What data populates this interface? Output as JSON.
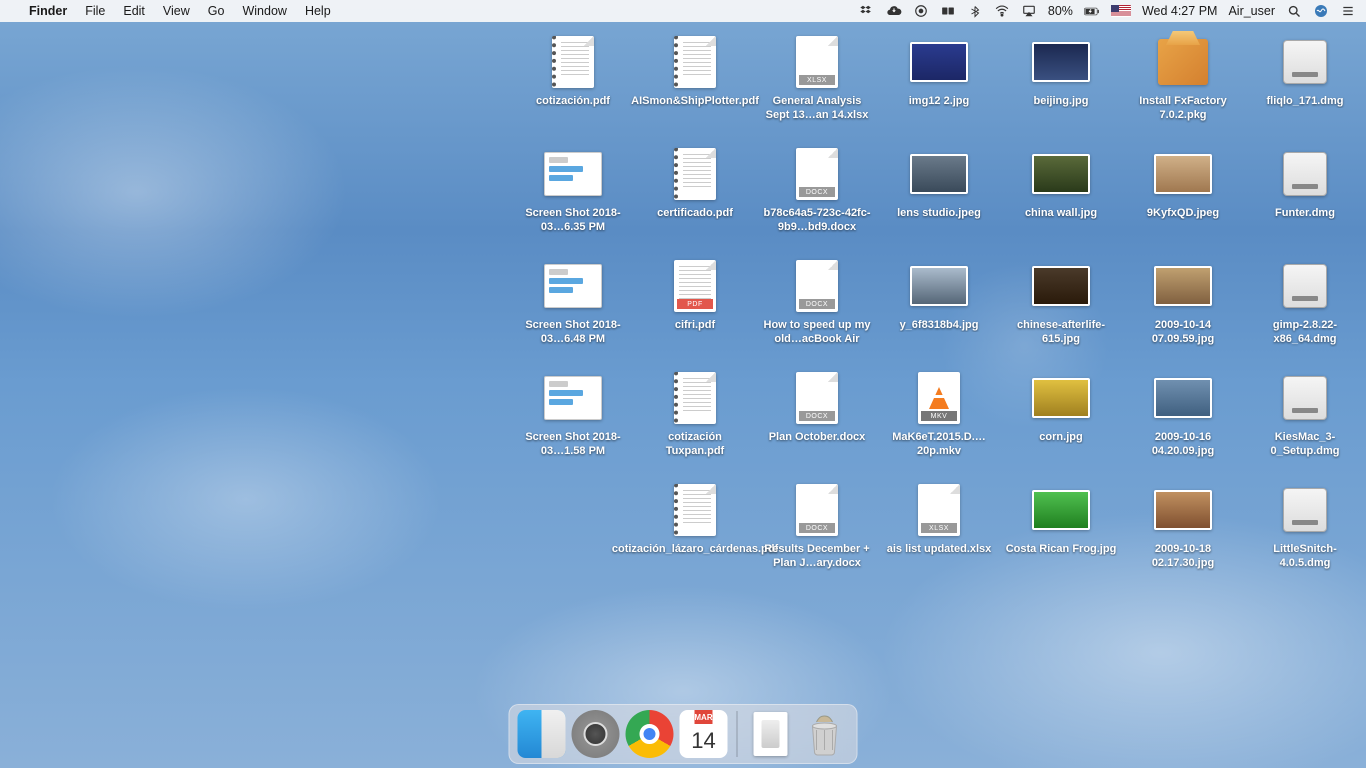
{
  "menubar": {
    "app": "Finder",
    "items": [
      "File",
      "Edit",
      "View",
      "Go",
      "Window",
      "Help"
    ],
    "battery": "80%",
    "clock": "Wed 4:27 PM",
    "user": "Air_user"
  },
  "dock": {
    "calendar_month": "MAR",
    "calendar_day": "14"
  },
  "files": {
    "r1": [
      {
        "label": "cotización.pdf",
        "type": "pdf-spiral"
      },
      {
        "label": "AISmon&ShipPlotter.pdf",
        "type": "pdf-spiral"
      },
      {
        "label": "General Analysis Sept 13…an 14.xlsx",
        "type": "xlsx"
      },
      {
        "label": "img12 2.jpg",
        "type": "jpg",
        "bg": "linear-gradient(#2a3b8f,#1c2766)"
      },
      {
        "label": "beijing.jpg",
        "type": "jpg",
        "bg": "linear-gradient(#1b2850,#3a5080)"
      },
      {
        "label": "Install FxFactory 7.0.2.pkg",
        "type": "pkg"
      },
      {
        "label": "fliqlo_171.dmg",
        "type": "dmg"
      }
    ],
    "r2": [
      {
        "label": "Screen Shot 2018-03…6.35 PM",
        "type": "screenshot"
      },
      {
        "label": "certificado.pdf",
        "type": "pdf-spiral"
      },
      {
        "label": "b78c64a5-723c-42fc-9b9…bd9.docx",
        "type": "docx"
      },
      {
        "label": "lens studio.jpeg",
        "type": "jpg",
        "bg": "linear-gradient(#6a7a8a,#3a4a5a)"
      },
      {
        "label": "china wall.jpg",
        "type": "jpg",
        "bg": "linear-gradient(#5a6a3a,#2a3a1a)"
      },
      {
        "label": "9KyfxQD.jpeg",
        "type": "jpg",
        "bg": "linear-gradient(#d0b088,#a07850)"
      },
      {
        "label": "Funter.dmg",
        "type": "dmg"
      }
    ],
    "r3": [
      {
        "label": "Screen Shot 2018-03…6.48 PM",
        "type": "screenshot"
      },
      {
        "label": "cifri.pdf",
        "type": "pdf"
      },
      {
        "label": "How to speed up my old…acBook Air",
        "type": "docx"
      },
      {
        "label": "y_6f8318b4.jpg",
        "type": "jpg",
        "bg": "linear-gradient(#aabbcc,#556677)"
      },
      {
        "label": "chinese-afterlife-615.jpg",
        "type": "jpg",
        "bg": "linear-gradient(#4a3a2a,#2a1a0a)"
      },
      {
        "label": "2009-10-14 07.09.59.jpg",
        "type": "jpg",
        "bg": "linear-gradient(#c0a070,#806040)"
      },
      {
        "label": "gimp-2.8.22-x86_64.dmg",
        "type": "dmg"
      }
    ],
    "r4": [
      {
        "label": "Screen Shot 2018-03…1.58 PM",
        "type": "screenshot"
      },
      {
        "label": "cotización Tuxpan.pdf",
        "type": "pdf-spiral"
      },
      {
        "label": "Plan October.docx",
        "type": "docx"
      },
      {
        "label": "MaK6eT.2015.D.…20p.mkv",
        "type": "mkv"
      },
      {
        "label": "corn.jpg",
        "type": "jpg",
        "bg": "linear-gradient(#e0c040,#a08020)"
      },
      {
        "label": "2009-10-16 04.20.09.jpg",
        "type": "jpg",
        "bg": "linear-gradient(#7090b0,#406080)"
      },
      {
        "label": "KiesMac_3-0_Setup.dmg",
        "type": "dmg"
      }
    ],
    "r5": [
      {
        "label": "cotización_lázaro_cárdenas.pdf",
        "type": "pdf-spiral"
      },
      {
        "label": "Results December + Plan J…ary.docx",
        "type": "docx"
      },
      {
        "label": "ais list updated.xlsx",
        "type": "xlsx"
      },
      {
        "label": "Costa Rican Frog.jpg",
        "type": "jpg",
        "bg": "linear-gradient(#50c050,#208020)"
      },
      {
        "label": "2009-10-18 02.17.30.jpg",
        "type": "jpg",
        "bg": "linear-gradient(#c09060,#805030)"
      },
      {
        "label": "LittleSnitch-4.0.5.dmg",
        "type": "dmg"
      }
    ]
  }
}
